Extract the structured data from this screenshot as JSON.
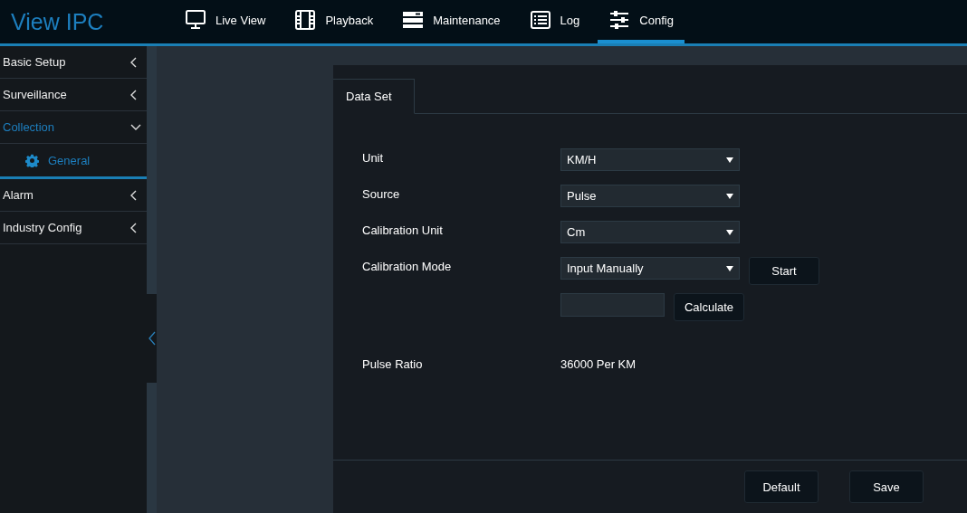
{
  "app": {
    "title": "View IPC"
  },
  "nav": [
    {
      "label": "Live View",
      "kind": "monitor",
      "selected": false
    },
    {
      "label": "Playback",
      "kind": "film",
      "selected": false
    },
    {
      "label": "Maintenance",
      "kind": "server",
      "selected": false
    },
    {
      "label": "Log",
      "kind": "list",
      "selected": false
    },
    {
      "label": "Config",
      "kind": "sliders",
      "selected": true
    }
  ],
  "sidebar": {
    "items": [
      {
        "label": "Basic Setup",
        "expanded": false
      },
      {
        "label": "Surveillance",
        "expanded": false
      },
      {
        "label": "Collection",
        "expanded": true,
        "children": [
          {
            "label": "General",
            "selected": true
          }
        ]
      },
      {
        "label": "Alarm",
        "expanded": false
      },
      {
        "label": "Industry Config",
        "expanded": false
      }
    ]
  },
  "tabs": [
    {
      "label": "Data Set",
      "selected": true
    }
  ],
  "form": [
    {
      "kind": "select",
      "label": "Unit",
      "value": "KM/H"
    },
    {
      "kind": "select",
      "label": "Source",
      "value": "Pulse"
    },
    {
      "kind": "select",
      "label": "Calibration Unit",
      "value": "Cm"
    },
    {
      "kind": "select",
      "label": "Calibration Mode",
      "value": "Input Manually",
      "button": "Start"
    },
    {
      "kind": "input",
      "button": "Calculate"
    },
    {
      "kind": "text",
      "label": "Pulse Ratio",
      "value": "36000 Per KM"
    }
  ],
  "buttons": [
    "Default",
    "Save"
  ]
}
